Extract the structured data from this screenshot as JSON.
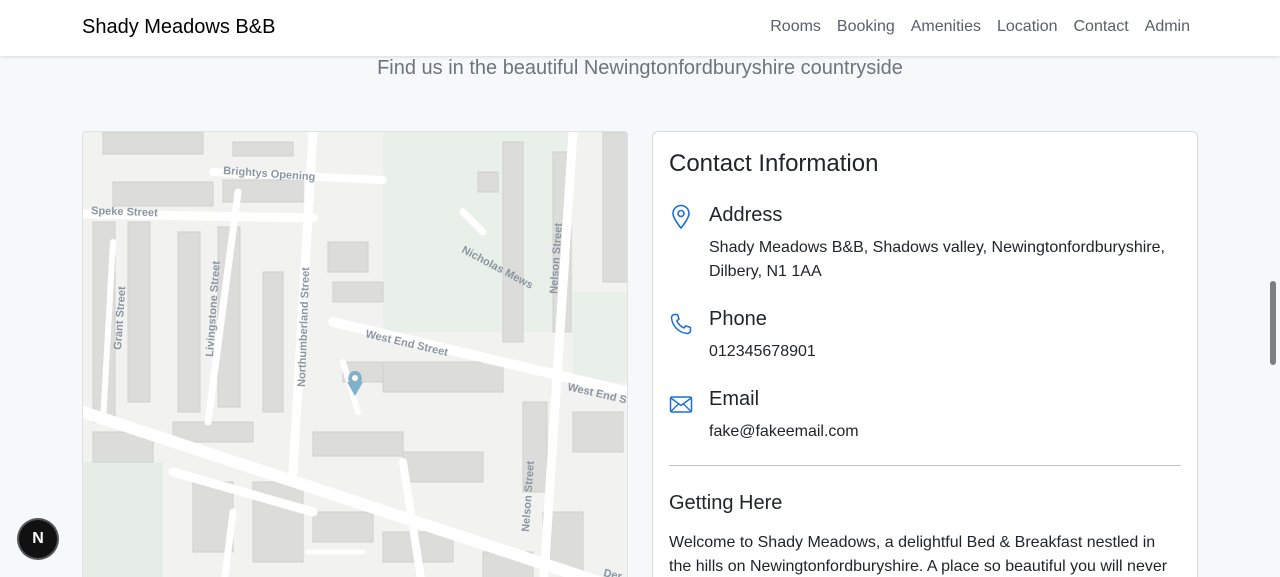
{
  "navbar": {
    "brand": "Shady Meadows B&B",
    "links": [
      "Rooms",
      "Booking",
      "Amenities",
      "Location",
      "Contact",
      "Admin"
    ]
  },
  "location": {
    "subtitle": "Find us in the beautiful Newingtonfordburyshire countryside"
  },
  "map": {
    "streets": [
      "Brightys Opening",
      "Speke Street",
      "Grant Street",
      "Livingstone Street",
      "Northumberland Street",
      "Nicholas Mews",
      "Nelson Street",
      "West End Street",
      "West End S",
      "Nelson Street",
      "Der"
    ],
    "marker_color": "#7fb2c8"
  },
  "contact": {
    "title": "Contact Information",
    "address": {
      "heading": "Address",
      "text": "Shady Meadows B&B, Shadows valley, Newingtonfordburyshire, Dilbery, N1 1AA",
      "icon": "location-pin-icon"
    },
    "phone": {
      "heading": "Phone",
      "text": "012345678901",
      "icon": "phone-icon"
    },
    "email": {
      "heading": "Email",
      "text": "fake@fakeemail.com",
      "icon": "envelope-icon"
    },
    "getting_here": {
      "heading": "Getting Here",
      "text": "Welcome to Shady Meadows, a delightful Bed & Breakfast nestled in the hills on Newingtonfordburyshire. A place so beautiful you will never"
    }
  },
  "badge": {
    "label": "N"
  },
  "colors": {
    "accent": "#0d6efd",
    "icon_blue": "#1a6fd6"
  }
}
